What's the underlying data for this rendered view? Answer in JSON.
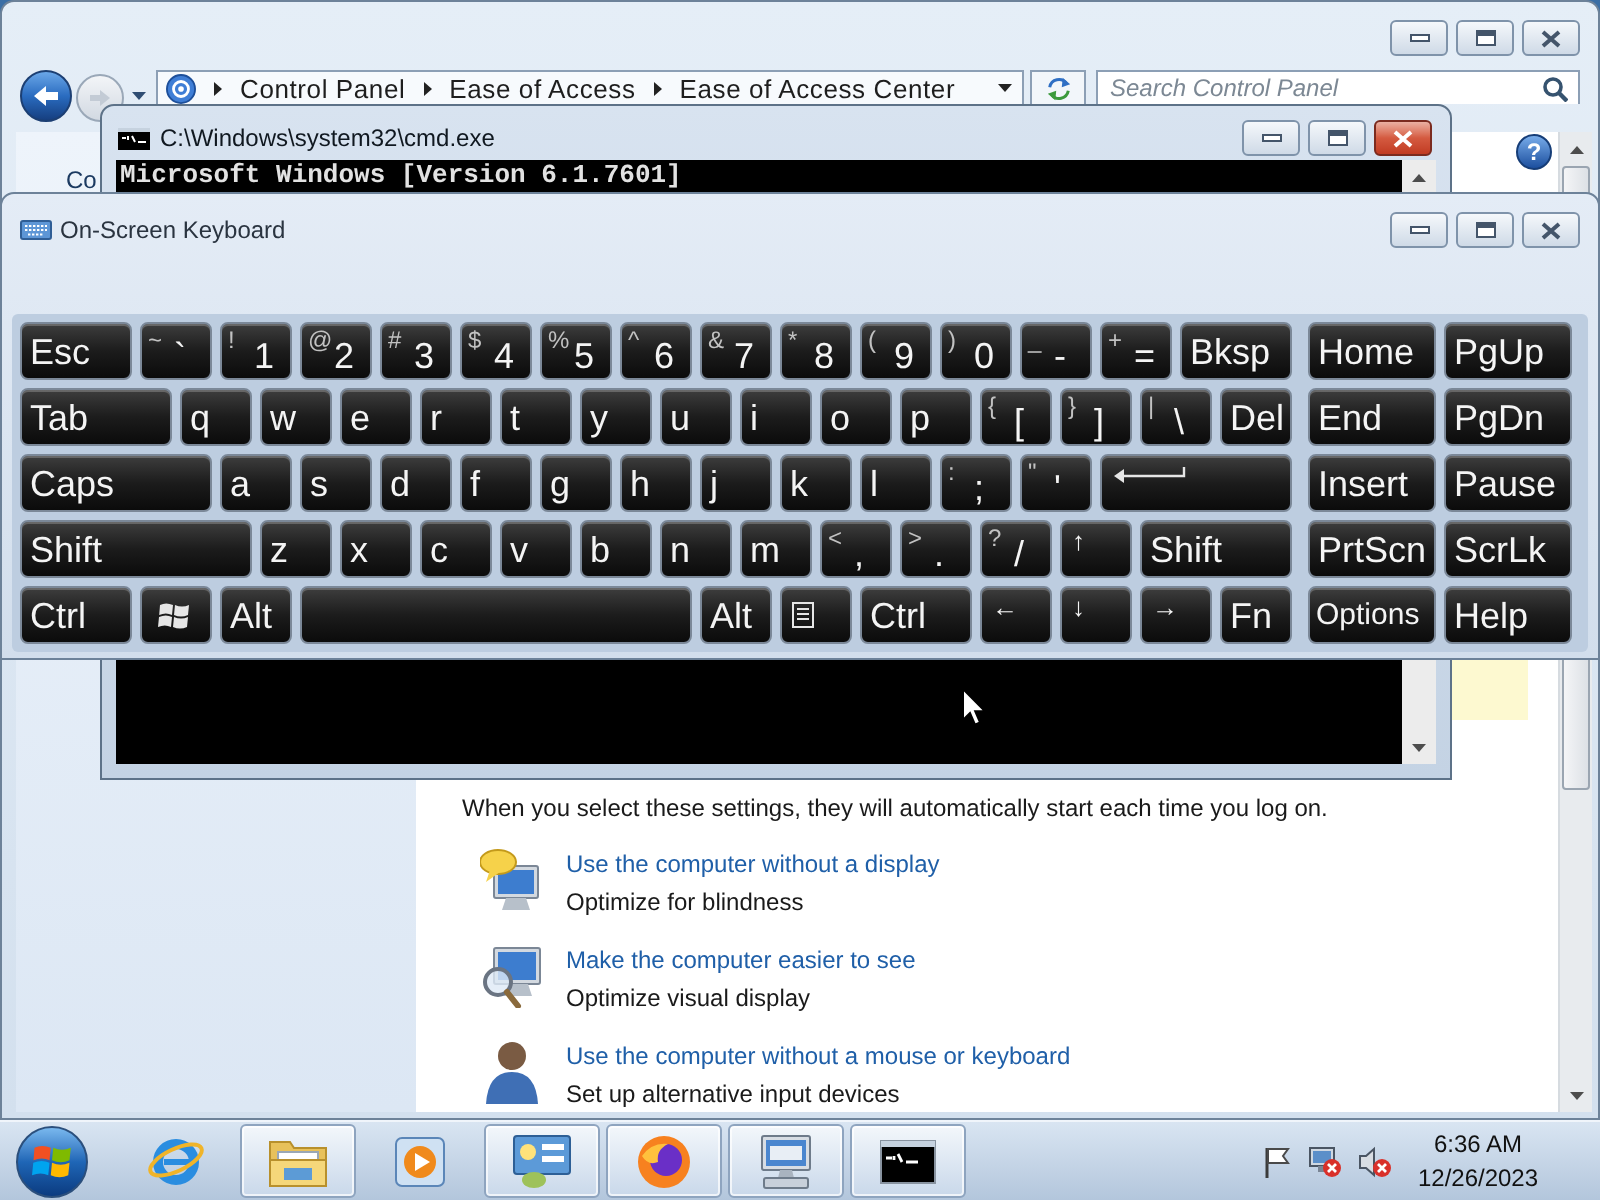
{
  "control_panel": {
    "active": false,
    "back": {
      "disabled": false
    },
    "forward": {
      "disabled": true
    },
    "breadcrumbs": [
      "Control Panel",
      "Ease of Access",
      "Ease of Access Center"
    ],
    "search": {
      "placeholder": "Search Control Panel"
    },
    "help_button": {
      "label": "?"
    },
    "sidebar": {
      "link": "Co"
    },
    "intro": "When you select these settings, they will automatically start each time you log on.",
    "options": [
      {
        "kind": "display",
        "link": "Use the computer without a display",
        "description": "Optimize for blindness"
      },
      {
        "kind": "visual",
        "link": "Make the computer easier to see",
        "description": "Optimize visual display"
      },
      {
        "kind": "input",
        "link": "Use the computer without a mouse or keyboard",
        "description": "Set up alternative input devices"
      }
    ]
  },
  "console_window": {
    "active": true,
    "title": "C:\\Windows\\system32\\cmd.exe",
    "lines": [
      "Microsoft Windows [Version 6.1.7601]"
    ]
  },
  "keyboard_window": {
    "active": false,
    "title": "On-Screen Keyboard",
    "rows": [
      {
        "keys": [
          {
            "kind": "text",
            "label": "Esc"
          },
          {
            "kind": "dual",
            "shift": "~",
            "label": "`"
          },
          {
            "kind": "dual",
            "shift": "!",
            "label": "1"
          },
          {
            "kind": "dual",
            "shift": "@",
            "label": "2"
          },
          {
            "kind": "dual",
            "shift": "#",
            "label": "3"
          },
          {
            "kind": "dual",
            "shift": "$",
            "label": "4"
          },
          {
            "kind": "dual",
            "shift": "%",
            "label": "5"
          },
          {
            "kind": "dual",
            "shift": "^",
            "label": "6"
          },
          {
            "kind": "dual",
            "shift": "&",
            "label": "7"
          },
          {
            "kind": "dual",
            "shift": "*",
            "label": "8"
          },
          {
            "kind": "dual",
            "shift": "(",
            "label": "9"
          },
          {
            "kind": "dual",
            "shift": ")",
            "label": "0"
          },
          {
            "kind": "dual",
            "shift": "_",
            "label": "-"
          },
          {
            "kind": "dual",
            "shift": "+",
            "label": "="
          },
          {
            "kind": "text",
            "label": "Bksp"
          }
        ],
        "nav": [
          {
            "kind": "text",
            "label": "Home"
          },
          {
            "kind": "text",
            "label": "PgUp"
          }
        ]
      },
      {
        "keys": [
          {
            "kind": "text",
            "label": "Tab"
          },
          {
            "kind": "text",
            "label": "q"
          },
          {
            "kind": "text",
            "label": "w"
          },
          {
            "kind": "text",
            "label": "e"
          },
          {
            "kind": "text",
            "label": "r"
          },
          {
            "kind": "text",
            "label": "t"
          },
          {
            "kind": "text",
            "label": "y"
          },
          {
            "kind": "text",
            "label": "u"
          },
          {
            "kind": "text",
            "label": "i"
          },
          {
            "kind": "text",
            "label": "o"
          },
          {
            "kind": "text",
            "label": "p"
          },
          {
            "kind": "dual",
            "shift": "{",
            "label": "["
          },
          {
            "kind": "dual",
            "shift": "}",
            "label": "]"
          },
          {
            "kind": "dual",
            "shift": "|",
            "label": "\\"
          },
          {
            "kind": "text",
            "label": "Del"
          }
        ],
        "nav": [
          {
            "kind": "text",
            "label": "End"
          },
          {
            "kind": "text",
            "label": "PgDn"
          }
        ]
      },
      {
        "keys": [
          {
            "kind": "text",
            "label": "Caps"
          },
          {
            "kind": "text",
            "label": "a"
          },
          {
            "kind": "text",
            "label": "s"
          },
          {
            "kind": "text",
            "label": "d"
          },
          {
            "kind": "text",
            "label": "f"
          },
          {
            "kind": "text",
            "label": "g"
          },
          {
            "kind": "text",
            "label": "h"
          },
          {
            "kind": "text",
            "label": "j"
          },
          {
            "kind": "text",
            "label": "k"
          },
          {
            "kind": "text",
            "label": "l"
          },
          {
            "kind": "dual",
            "shift": ":",
            "label": ";"
          },
          {
            "kind": "dual",
            "shift": "\"",
            "label": "'"
          },
          {
            "kind": "enter"
          }
        ],
        "nav": [
          {
            "kind": "text",
            "label": "Insert"
          },
          {
            "kind": "text",
            "label": "Pause"
          }
        ]
      },
      {
        "keys": [
          {
            "kind": "text",
            "label": "Shift"
          },
          {
            "kind": "text",
            "label": "z"
          },
          {
            "kind": "text",
            "label": "x"
          },
          {
            "kind": "text",
            "label": "c"
          },
          {
            "kind": "text",
            "label": "v"
          },
          {
            "kind": "text",
            "label": "b"
          },
          {
            "kind": "text",
            "label": "n"
          },
          {
            "kind": "text",
            "label": "m"
          },
          {
            "kind": "dual",
            "shift": "<",
            "label": ","
          },
          {
            "kind": "dual",
            "shift": ">",
            "label": "."
          },
          {
            "kind": "dual",
            "shift": "?",
            "label": "/"
          },
          {
            "kind": "arrow",
            "label": "↑"
          },
          {
            "kind": "text",
            "label": "Shift"
          }
        ],
        "nav": [
          {
            "kind": "text",
            "label": "PrtScn"
          },
          {
            "kind": "text",
            "label": "ScrLk"
          }
        ]
      },
      {
        "keys": [
          {
            "kind": "text",
            "label": "Ctrl"
          },
          {
            "kind": "logo"
          },
          {
            "kind": "text",
            "label": "Alt"
          },
          {
            "kind": "space"
          },
          {
            "kind": "text",
            "label": "Alt"
          },
          {
            "kind": "menu"
          },
          {
            "kind": "text",
            "label": "Ctrl"
          },
          {
            "kind": "arrow",
            "label": "←"
          },
          {
            "kind": "arrow",
            "label": "↓"
          },
          {
            "kind": "arrow",
            "label": "→"
          },
          {
            "kind": "text",
            "label": "Fn"
          }
        ],
        "nav": [
          {
            "kind": "compact",
            "label": "Options"
          },
          {
            "kind": "text",
            "label": "Help"
          }
        ]
      }
    ]
  },
  "taskbar": {
    "items": [
      {
        "kind": "browser",
        "running": false
      },
      {
        "kind": "folder",
        "running": true
      },
      {
        "kind": "media",
        "running": false
      },
      {
        "kind": "panel",
        "running": true
      },
      {
        "kind": "globe",
        "running": true
      },
      {
        "kind": "keyboard",
        "running": true
      },
      {
        "kind": "console",
        "running": true
      }
    ],
    "clock": {
      "time": "6:36 AM",
      "date": "12/26/2023"
    }
  }
}
